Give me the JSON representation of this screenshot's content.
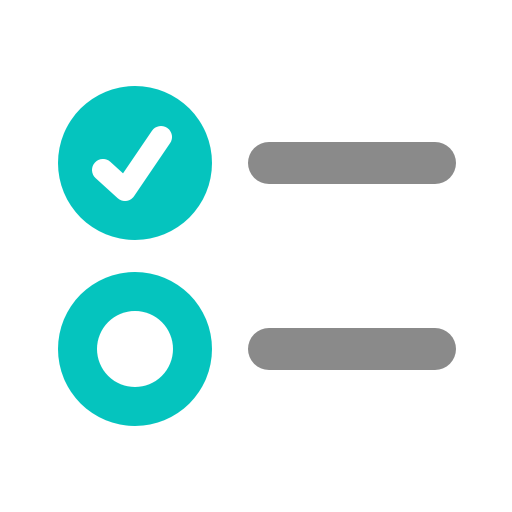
{
  "icon": {
    "name": "checklist-icon",
    "colors": {
      "accent": "#05C4BE",
      "line": "#8A8A8A",
      "background": "#FFFFFF"
    },
    "items": [
      {
        "marker_icon": "checked-circle-icon",
        "checked": true
      },
      {
        "marker_icon": "empty-circle-icon",
        "checked": false
      }
    ]
  }
}
